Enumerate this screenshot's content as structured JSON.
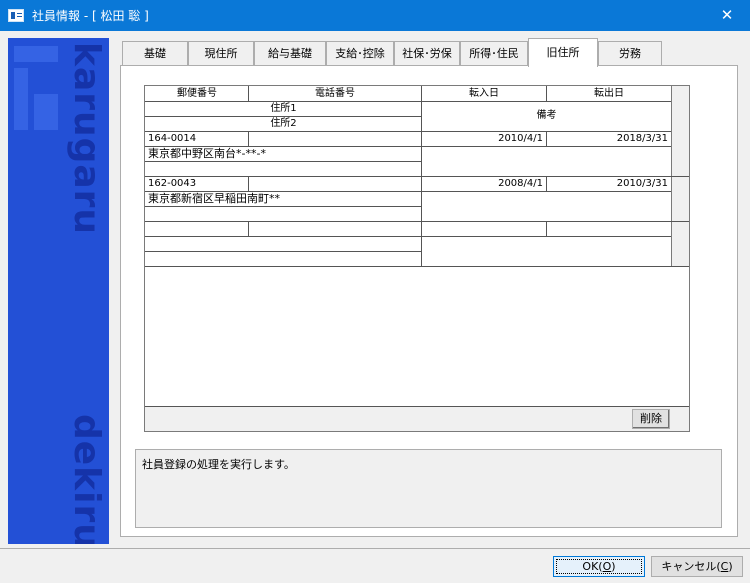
{
  "window": {
    "title": "社員情報 - [ 松田 聡 ]",
    "close_glyph": "✕"
  },
  "sidebar": {
    "brand_top": "karugaru",
    "brand_bottom": "dekiru"
  },
  "tabs": [
    {
      "label": "基礎",
      "active": false
    },
    {
      "label": "現住所",
      "active": false
    },
    {
      "label": "給与基礎",
      "active": false
    },
    {
      "label": "支給･控除",
      "active": false
    },
    {
      "label": "社保･労保",
      "active": false
    },
    {
      "label": "所得･住民",
      "active": false
    },
    {
      "label": "旧住所",
      "active": true
    },
    {
      "label": "労務",
      "active": false
    }
  ],
  "grid": {
    "headers": {
      "postal": "郵便番号",
      "phone": "電話番号",
      "move_in": "転入日",
      "move_out": "転出日",
      "address1": "住所1",
      "address2": "住所2",
      "notes": "備考"
    },
    "rows": [
      {
        "postal": "164-0014",
        "phone": "",
        "move_in": "2010/4/1",
        "move_out": "2018/3/31",
        "address1": "東京都中野区南台*-**-*",
        "address2": "",
        "notes": ""
      },
      {
        "postal": "162-0043",
        "phone": "",
        "move_in": "2008/4/1",
        "move_out": "2010/3/31",
        "address1": "東京都新宿区早稲田南町**",
        "address2": "",
        "notes": ""
      },
      {
        "postal": "",
        "phone": "",
        "move_in": "",
        "move_out": "",
        "address1": "",
        "address2": "",
        "notes": ""
      }
    ],
    "delete_label": "削除"
  },
  "message": "社員登録の処理を実行します。",
  "buttons": {
    "ok_label": "OK(",
    "ok_key": "O",
    "ok_suffix": ")",
    "cancel_label": "キャンセル(",
    "cancel_key": "C",
    "cancel_suffix": ")"
  }
}
